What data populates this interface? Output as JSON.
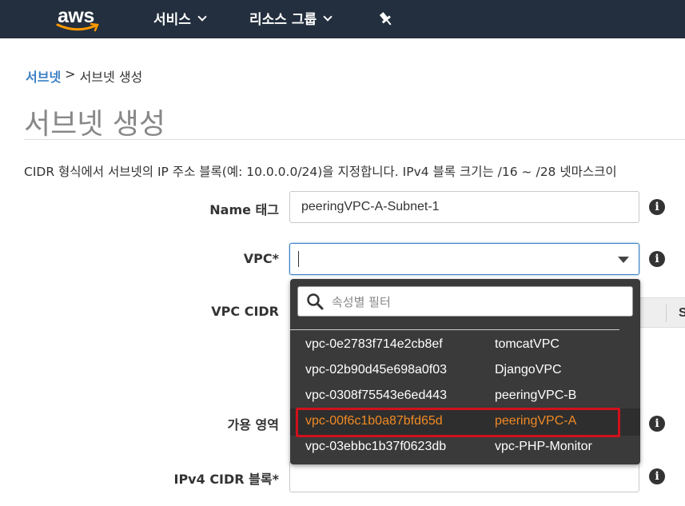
{
  "nav": {
    "logo": "aws",
    "services": "서비스",
    "resource_groups": "리소스 그룹",
    "icons": {
      "dropdown": "chevron-down-icon",
      "pin": "pin-icon"
    }
  },
  "breadcrumb": {
    "link": "서브넷",
    "separator": ">",
    "current": "서브넷 생성"
  },
  "page_title": "서브넷 생성",
  "description": "CIDR 형식에서 서브넷의 IP 주소 블록(예: 10.0.0.0/24)을 지정합니다. IPv4 블록 크기는 /16 ~ /28 넷마스크이",
  "form": {
    "name_tag": {
      "label": "Name 태그",
      "value": "peeringVPC-A-Subnet-1"
    },
    "vpc": {
      "label": "VPC*",
      "value": ""
    },
    "vpc_cidr": {
      "label": "VPC CIDR"
    },
    "availability_zone": {
      "label": "가용 영역"
    },
    "ipv4_cidr": {
      "label": "IPv4 CIDR 블록*",
      "value": ""
    },
    "info_icon": "i"
  },
  "table_peek": {
    "header_fragment": "S"
  },
  "dropdown": {
    "filter_placeholder": "속성별 필터",
    "options": [
      {
        "id": "vpc-0e2783f714e2cb8ef",
        "name": "tomcatVPC",
        "selected": false
      },
      {
        "id": "vpc-02b90d45e698a0f03",
        "name": "DjangoVPC",
        "selected": false
      },
      {
        "id": "vpc-0308f75543e6ed443",
        "name": "peeringVPC-B",
        "selected": false
      },
      {
        "id": "vpc-00f6c1b0a87bfd65d",
        "name": "peeringVPC-A",
        "selected": true
      },
      {
        "id": "vpc-03ebbc1b37f0623db",
        "name": "vpc-PHP-Monitor",
        "selected": false
      }
    ]
  },
  "colors": {
    "nav_bg": "#232f3e",
    "accent": "#f08a24",
    "highlight_box": "#d0121b",
    "link": "#3b7fc4"
  }
}
